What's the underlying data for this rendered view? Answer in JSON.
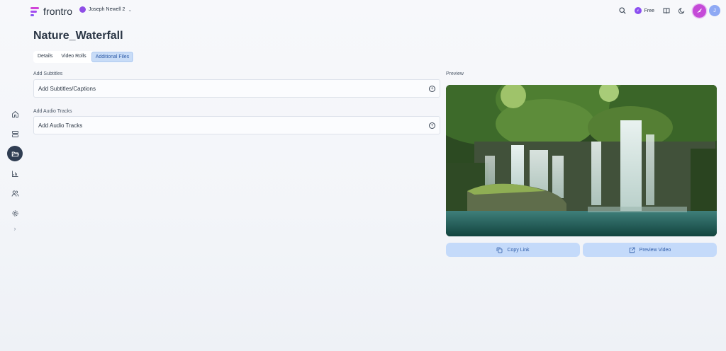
{
  "app": {
    "name": "frontro"
  },
  "workspace": {
    "name": "Joseph Newell 2"
  },
  "header": {
    "plan_label": "Free",
    "user_initial": "J"
  },
  "page": {
    "title": "Nature_Waterfall"
  },
  "tabs": [
    {
      "label": "Details"
    },
    {
      "label": "Video Rolls"
    },
    {
      "label": "Additional Files",
      "active": true
    }
  ],
  "subtitles": {
    "section_label": "Add Subtitles",
    "field_label": "Add Subtitles/Captions"
  },
  "audio": {
    "section_label": "Add Audio Tracks",
    "field_label": "Add Audio Tracks"
  },
  "preview": {
    "label": "Preview"
  },
  "actions": {
    "copy_link": "Copy Link",
    "preview_video": "Preview Video"
  },
  "icons": {
    "sidebar": [
      "home-icon",
      "layers-icon",
      "folder-open-icon",
      "bar-chart-icon",
      "users-icon",
      "settings-icon"
    ],
    "expand": "chevron-right-icon"
  },
  "colors": {
    "brand": "#c54ad8",
    "accent": "#c4dafa",
    "active_tab": "#c8dcf7",
    "sidebar_active": "#2f3d52"
  }
}
